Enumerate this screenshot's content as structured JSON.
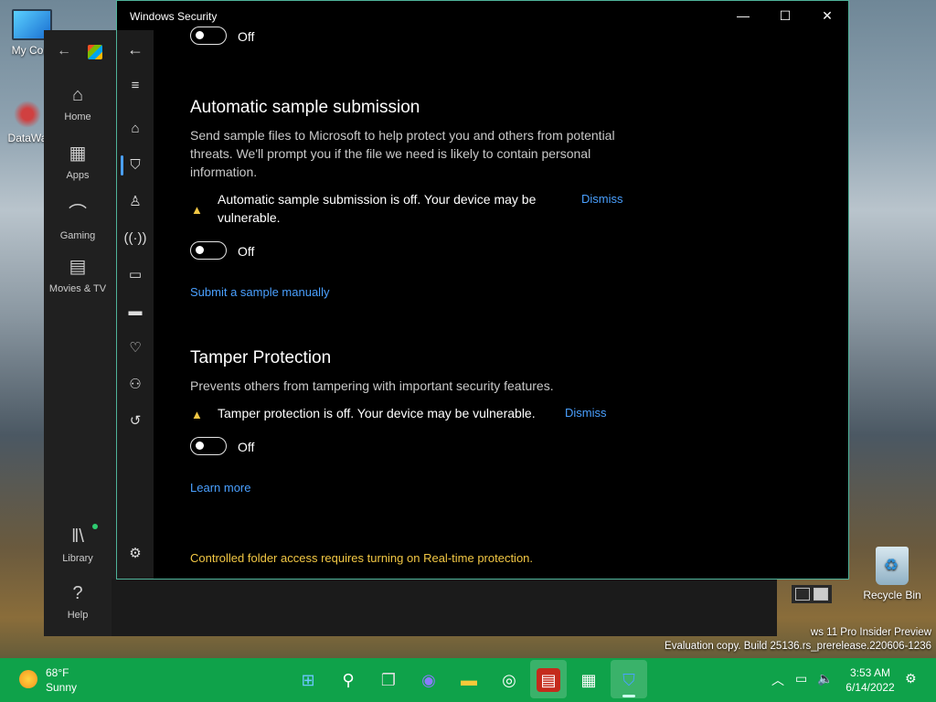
{
  "desktop": {
    "icons": [
      {
        "label": "My Com",
        "icon": "computer-icon"
      },
      {
        "label": "DataWa",
        "icon": "datawave-icon"
      },
      {
        "label": "Recycle Bin",
        "icon": "recycle-bin-icon"
      }
    ],
    "build_line1": "ws 11 Pro Insider Preview",
    "build_line2": "Evaluation copy. Build 25136.rs_prerelease.220606-1236"
  },
  "xbox": {
    "nav": [
      {
        "label": "Home",
        "icon": "home-icon"
      },
      {
        "label": "Apps",
        "icon": "apps-icon"
      },
      {
        "label": "Gaming",
        "icon": "controller-icon"
      },
      {
        "label": "Movies & TV",
        "icon": "movies-icon"
      }
    ],
    "bottom_nav": [
      {
        "label": "Library",
        "icon": "library-icon"
      },
      {
        "label": "Help",
        "icon": "help-icon"
      }
    ]
  },
  "window": {
    "title": "Windows Security",
    "rail_icons": [
      "back-icon",
      "menu-icon",
      "home-icon",
      "shield-icon",
      "account-icon",
      "network-icon",
      "app-browser-icon",
      "device-icon",
      "health-icon",
      "family-icon",
      "history-icon",
      "settings-icon"
    ],
    "active_rail_index": 3
  },
  "content": {
    "top_toggle_label": "Off",
    "sample": {
      "heading": "Automatic sample submission",
      "description": "Send sample files to Microsoft to help protect you and others from potential threats. We'll prompt you if the file we need is likely to contain personal information.",
      "warning": "Automatic sample submission is off. Your device may be vulnerable.",
      "dismiss": "Dismiss",
      "toggle_label": "Off",
      "link": "Submit a sample manually"
    },
    "tamper": {
      "heading": "Tamper Protection",
      "description": "Prevents others from tampering with important security features.",
      "warning": "Tamper protection is off. Your device may be vulnerable.",
      "dismiss": "Dismiss",
      "toggle_label": "Off",
      "link": "Learn more"
    },
    "folder_note": "Controlled folder access requires turning on Real-time protection."
  },
  "taskbar": {
    "weather_temp": "68°F",
    "weather_desc": "Sunny",
    "apps": [
      "start-icon",
      "search-icon",
      "task-view-icon",
      "chat-icon",
      "file-explorer-icon",
      "chrome-icon",
      "news-icon",
      "store-icon",
      "windows-security-icon"
    ],
    "time": "3:53 AM",
    "date": "6/14/2022"
  }
}
